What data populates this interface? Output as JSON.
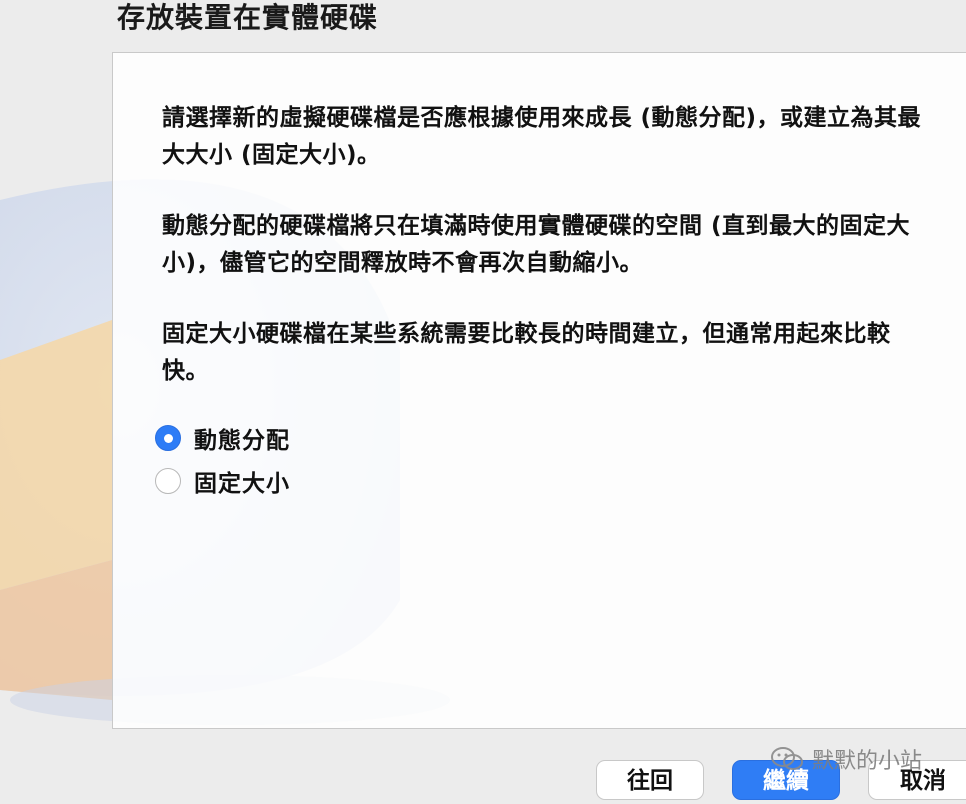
{
  "page": {
    "title": "存放裝置在實體硬碟"
  },
  "description": {
    "paragraph1": "請選擇新的虛擬硬碟檔是否應根據使用來成長 (動態分配)，或建立為其最大大小 (固定大小)。",
    "paragraph2": "動態分配的硬碟檔將只在填滿時使用實體硬碟的空間 (直到最大的固定大小)，儘管它的空間釋放時不會再次自動縮小。",
    "paragraph3": "固定大小硬碟檔在某些系統需要比較長的時間建立，但通常用起來比較快。"
  },
  "options": [
    {
      "label": "動態分配",
      "selected": true
    },
    {
      "label": "固定大小",
      "selected": false
    }
  ],
  "buttons": {
    "back_label": "往回",
    "next_label": "繼續",
    "cancel_label": "取消"
  },
  "watermark": {
    "text": "默默的小站"
  },
  "colors": {
    "accent": "#2f7df5",
    "background": "#ececec"
  },
  "icons": {
    "watermark": "wechat-icon"
  }
}
